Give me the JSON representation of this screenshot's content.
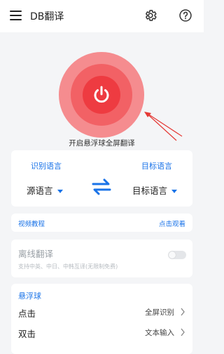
{
  "app": {
    "title": "DB翻译"
  },
  "toolbar": {
    "menu_icon": "menu-icon",
    "settings_icon": "gear-icon",
    "help_icon": "help-circle-icon"
  },
  "hero": {
    "caption": "开启悬浮球全屏翻译",
    "power_icon": "power-icon",
    "colors": {
      "outer": "#f58c8f",
      "mid": "#f26165",
      "inner": "#ee3b41",
      "annotation": "#e53935"
    }
  },
  "language": {
    "source_header": "识别语言",
    "target_header": "目标语言",
    "source_value": "源语言",
    "target_value": "目标语言",
    "swap_icon": "swap-arrows-icon",
    "accent": "#1a73e8"
  },
  "video": {
    "label": "视频教程",
    "link": "点击观看"
  },
  "offline": {
    "title": "离线翻译",
    "description": "支持中英、中日、中韩互译(无限制免费)",
    "enabled": false
  },
  "float_ball": {
    "header": "悬浮球",
    "rows": [
      {
        "label": "点击",
        "value": "全屏识别"
      },
      {
        "label": "双击",
        "value": "文本输入"
      }
    ]
  }
}
